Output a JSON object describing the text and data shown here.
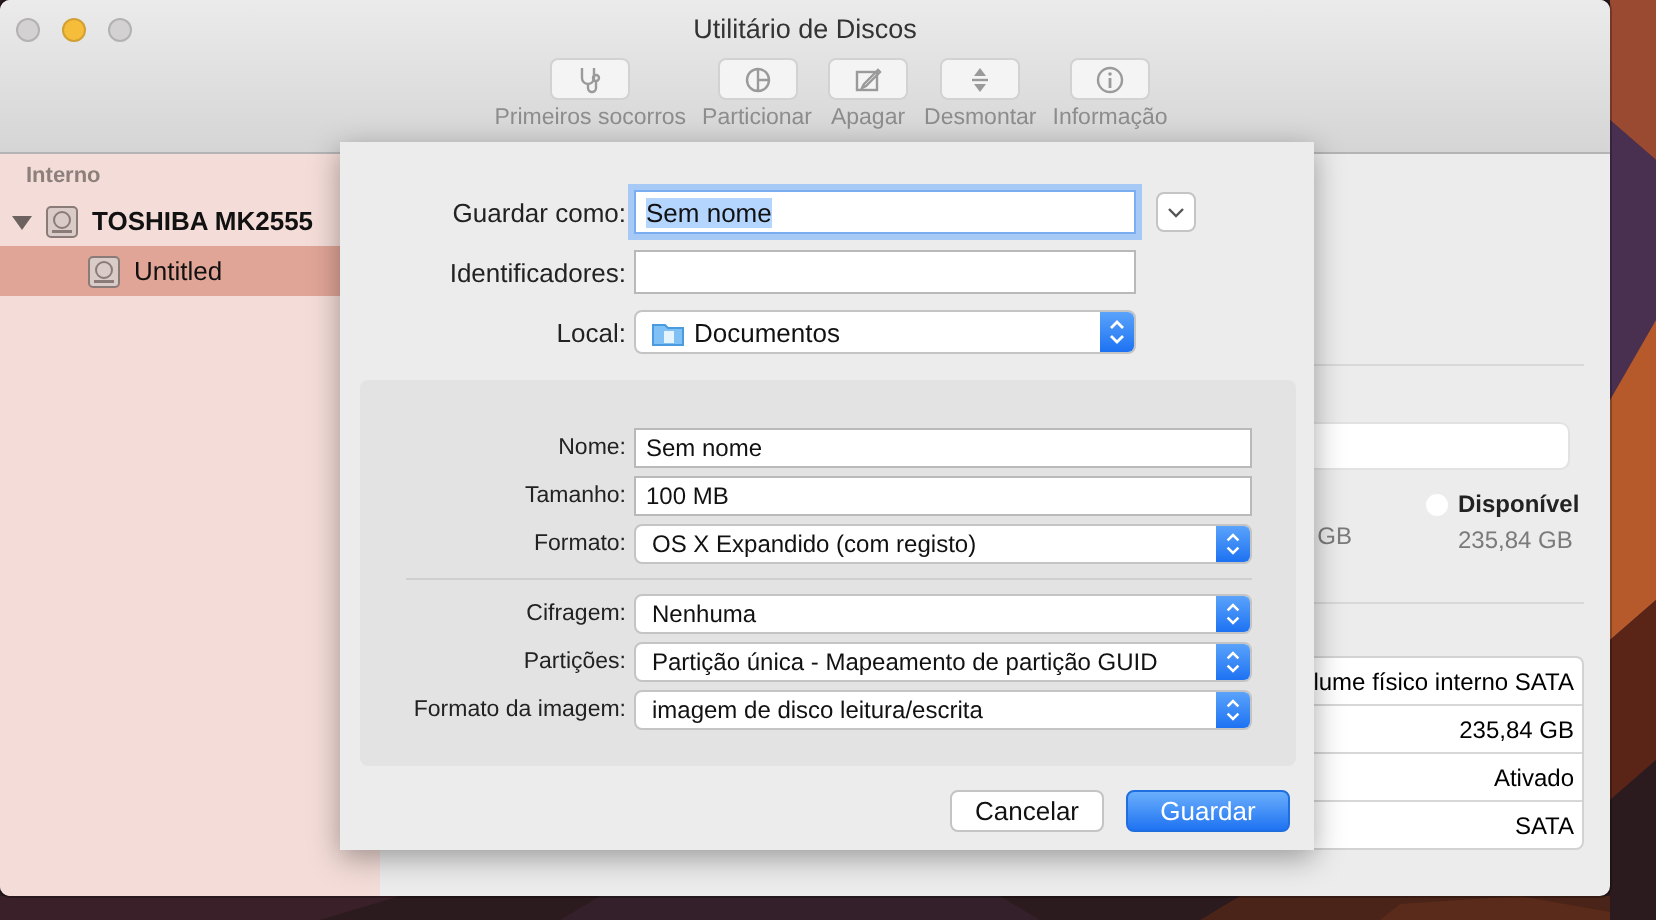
{
  "window": {
    "title": "Utilitário de Discos",
    "controls": [
      {
        "color": "#d3d1d1"
      },
      {
        "color": "#f6bd3b"
      },
      {
        "color": "#d3d1d1"
      }
    ]
  },
  "toolbar": [
    {
      "kind": "stethoscope",
      "label": "Primeiros socorros"
    },
    {
      "kind": "pie",
      "label": "Particionar"
    },
    {
      "kind": "erase",
      "label": "Apagar"
    },
    {
      "kind": "unmount",
      "label": "Desmontar"
    },
    {
      "kind": "info",
      "label": "Informação"
    }
  ],
  "sidebar": {
    "section": "Interno",
    "items": [
      {
        "label": "TOSHIBA MK2555",
        "expanded": true,
        "selected": false,
        "children": [
          {
            "label": "Untitled",
            "selected": true
          }
        ]
      }
    ]
  },
  "details": {
    "partial_reading": "GB",
    "legend": {
      "label": "Disponível",
      "color": "#ffffff",
      "reading": "235,84 GB"
    },
    "info_rows": [
      "lume físico interno SATA",
      "235,84 GB",
      "Ativado",
      "SATA"
    ]
  },
  "sheet": {
    "save_as": {
      "label": "Guardar como:",
      "value": "Sem nome",
      "focused": true
    },
    "expand_button": {
      "expanded": false
    },
    "tags": {
      "label": "Identificadores:"
    },
    "location": {
      "label": "Local:",
      "value": "Documentos"
    },
    "panel": {
      "groups": [
        [
          {
            "kind": "text",
            "label": "Nome:",
            "value": "Sem nome"
          },
          {
            "kind": "text",
            "label": "Tamanho:",
            "value": "100 MB"
          },
          {
            "kind": "popup",
            "label": "Formato:",
            "value": "OS X Expandido (com registo)"
          }
        ],
        [
          {
            "kind": "popup",
            "label": "Cifragem:",
            "value": "Nenhuma"
          },
          {
            "kind": "popup",
            "label": "Partições:",
            "value": "Partição única - Mapeamento de partição GUID"
          },
          {
            "kind": "popup",
            "label": "Formato da imagem:",
            "value": "imagem de disco leitura/escrita"
          }
        ]
      ]
    },
    "buttons": [
      {
        "label": "Cancelar",
        "default": false
      },
      {
        "label": "Guardar",
        "default": true
      }
    ]
  }
}
